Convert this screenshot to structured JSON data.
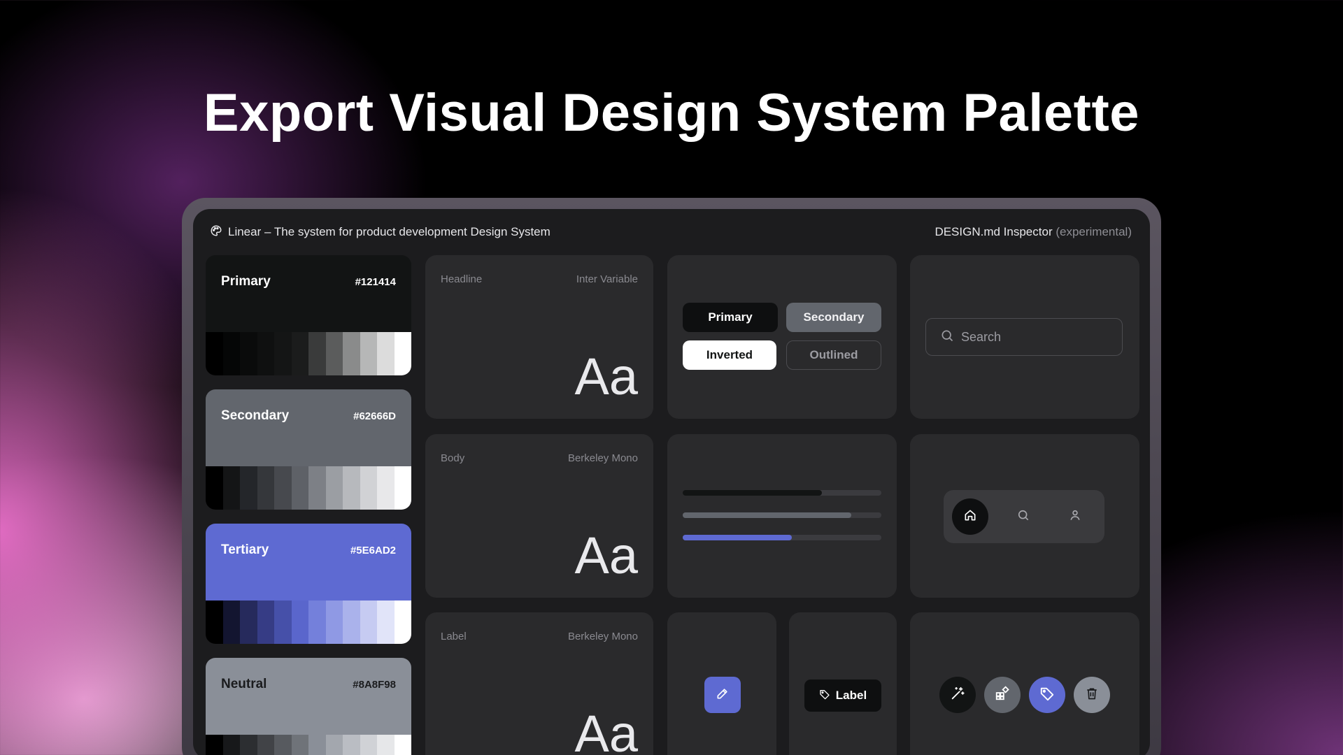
{
  "headline": "Export Visual Design System Palette",
  "window": {
    "title": "Linear – The system for product development Design System",
    "inspector_label": "DESIGN.md Inspector",
    "inspector_badge": "(experimental)"
  },
  "swatches": [
    {
      "name": "Primary",
      "hex": "#121414",
      "bg": "#121414",
      "text": "#ffffff",
      "ramp": [
        "#000000",
        "#050606",
        "#0a0b0b",
        "#0f1010",
        "#141515",
        "#1b1c1c",
        "#3a3b3b",
        "#5b5c5c",
        "#8a8b8b",
        "#b6b7b7",
        "#dcdcdc",
        "#ffffff"
      ]
    },
    {
      "name": "Secondary",
      "hex": "#62666D",
      "bg": "#62666d",
      "text": "#ffffff",
      "ramp": [
        "#000000",
        "#141516",
        "#24262a",
        "#35373b",
        "#47494e",
        "#5e6167",
        "#7d8086",
        "#9b9ea3",
        "#b7b9bd",
        "#d1d2d5",
        "#e8e8ea",
        "#ffffff"
      ]
    },
    {
      "name": "Tertiary",
      "hex": "#5E6AD2",
      "bg": "#5e6ad2",
      "text": "#ffffff",
      "ramp": [
        "#000000",
        "#131530",
        "#262a5c",
        "#363c85",
        "#4650a9",
        "#5a66cc",
        "#7480db",
        "#8f99e4",
        "#aab2eb",
        "#c6cbf2",
        "#e1e4f9",
        "#ffffff"
      ]
    },
    {
      "name": "Neutral",
      "hex": "#8A8F98",
      "bg": "#8a8f98",
      "text": "#1b1c1e",
      "ramp": [
        "#000000",
        "#17181a",
        "#2c2e31",
        "#414347",
        "#575a5f",
        "#6f7379",
        "#8a8f98",
        "#a3a7ae",
        "#babdc3",
        "#d0d2d6",
        "#e6e7e9",
        "#ffffff"
      ]
    }
  ],
  "typography": [
    {
      "role": "Headline",
      "font": "Inter Variable",
      "sample": "Aa"
    },
    {
      "role": "Body",
      "font": "Berkeley Mono",
      "sample": "Aa"
    },
    {
      "role": "Label",
      "font": "Berkeley Mono",
      "sample": "Aa"
    }
  ],
  "buttons": {
    "primary": "Primary",
    "secondary": "Secondary",
    "inverted": "Inverted",
    "outlined": "Outlined"
  },
  "search": {
    "placeholder": "Search"
  },
  "progress": [
    {
      "value": 0.7,
      "color": "#121414"
    },
    {
      "value": 0.85,
      "color": "#62666d"
    },
    {
      "value": 0.55,
      "color": "#5e6ad2"
    }
  ],
  "nav": {
    "icons": [
      "home-icon",
      "search-icon",
      "user-icon"
    ],
    "active": "home-icon"
  },
  "edit_button": {
    "icon": "pencil-icon",
    "color": "#5e6ad2"
  },
  "chip": {
    "label": "Label",
    "icon": "tag-icon"
  },
  "action_buttons": [
    {
      "icon": "magic-wand-icon",
      "color": "#121414"
    },
    {
      "icon": "grid-add-icon",
      "color": "#62666d"
    },
    {
      "icon": "tag-icon",
      "color": "#5e6ad2"
    },
    {
      "icon": "trash-icon",
      "color": "#8a8f98"
    }
  ]
}
